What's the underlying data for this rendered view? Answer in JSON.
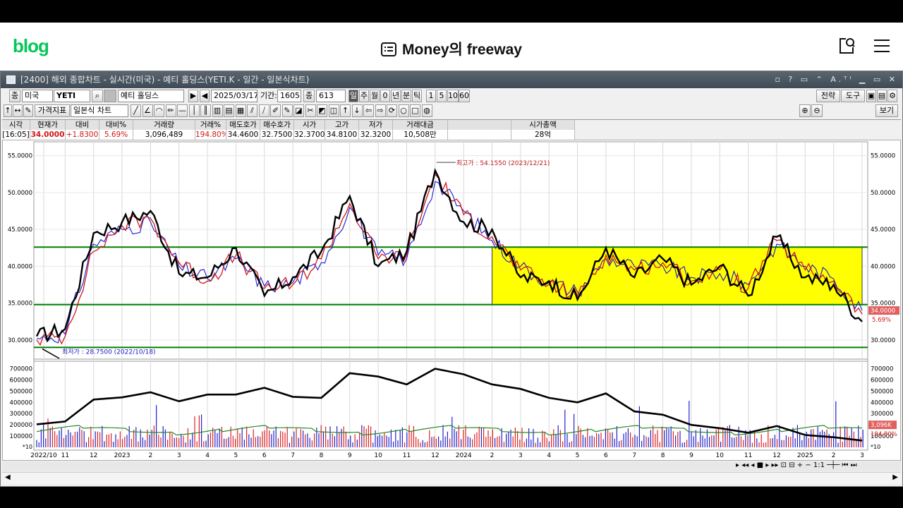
{
  "blog": {
    "logo": "blog",
    "title": "Money의 freeway"
  },
  "window": {
    "title": "[2400] 해외 종합차트 - 실시간(미국) - 예티 홀딩스(YETI.K - 일간 - 일본식차트)",
    "controls": "▫ ? ▭ ⌃ A.ᵀᴵ ▁ ▭ ✕"
  },
  "toolbar1": {
    "type_label": "종",
    "market": "미국",
    "ticker": "YETI",
    "name": "예티 홀딩스",
    "date": "2025/03/17",
    "period_label": "기간:",
    "period": "1605",
    "count_label": "종",
    "count": "613",
    "intervals": [
      "일",
      "주",
      "월",
      "0",
      "년",
      "분",
      "틱",
      "1",
      "5",
      "10",
      "60"
    ],
    "right_buttons": [
      "전략",
      "도구"
    ]
  },
  "toolbar2": {
    "indicator_label": "가격지표",
    "chart_type": "일본식 차트",
    "view_label": "보기"
  },
  "info": {
    "headers": [
      "시각",
      "현재가",
      "대비",
      "대비%",
      "거래량",
      "거래%",
      "매도호가",
      "매수호가",
      "시가",
      "고가",
      "저가",
      "거래대금",
      "",
      "시가총액"
    ],
    "values": [
      "[16:05]",
      "34.0000",
      "+1.8300",
      "5.69%",
      "3,096,489",
      "194.80%",
      "34.4600",
      "32.7500",
      "32.3700",
      "34.8100",
      "32.3200",
      "10,508만",
      "",
      "28억"
    ]
  },
  "annotations": {
    "high": "최고가 : 54.1550 (2023/12/21)",
    "low": "최저가 : 28.7500 (2022/10/18)",
    "current_price": "34.0000",
    "current_pct": "5.69%",
    "volume_current": "3,096K",
    "volume_pct": "194.80%",
    "price_mult": "",
    "vol_mult": "*10"
  },
  "colors": {
    "price": "#000000",
    "ma_red": "#d01818",
    "ma_blue": "#1a1acc",
    "support": "#008000",
    "box": "#ffff00",
    "vol_ma": "#2a8a2a"
  },
  "chart_data": {
    "type": "line",
    "price_axis": {
      "ticks": [
        "55.0000",
        "50.0000",
        "45.0000",
        "40.0000",
        "35.0000",
        "30.0000"
      ],
      "ylim": [
        27.5,
        56.5
      ]
    },
    "volume_axis": {
      "ticks": [
        "700000",
        "600000",
        "500000",
        "400000",
        "300000",
        "200000",
        "100000"
      ],
      "ylim": [
        0,
        760000
      ]
    },
    "x_ticks": [
      "2022/10",
      "11",
      "12",
      "2023",
      "2",
      "3",
      "4",
      "5",
      "6",
      "7",
      "8",
      "9",
      "10",
      "11",
      "12",
      "2024",
      "2",
      "3",
      "4",
      "5",
      "6",
      "7",
      "8",
      "9",
      "10",
      "11",
      "12",
      "2025",
      "2",
      "3"
    ],
    "horizontal_lines": [
      42.6,
      34.8,
      29.0
    ],
    "highlight_box": {
      "from": "2024/02",
      "to": "2025/03",
      "low": 34.8,
      "high": 42.6
    },
    "series": [
      {
        "name": "",
        "x": [
          "2022/10",
          "2022/11",
          "2022/12",
          "2023/01",
          "2023/02",
          "2023/03",
          "2023/04",
          "2023/05",
          "2023/06",
          "2023/07",
          "2023/08",
          "2023/09",
          "2023/10",
          "2023/11",
          "2023/12",
          "2024/01",
          "2024/02",
          "2024/03",
          "2024/04",
          "2024/05",
          "2024/06",
          "2024/07",
          "2024/08",
          "2024/09",
          "2024/10",
          "2024/11",
          "2024/12",
          "2025/01",
          "2025/02",
          "2025/03"
        ],
        "values": [
          30.5,
          31.5,
          44.5,
          46.0,
          47.5,
          39.0,
          38.5,
          42.5,
          36.0,
          38.5,
          42.0,
          49.5,
          40.0,
          42.0,
          53.0,
          46.0,
          45.0,
          38.5,
          38.0,
          35.5,
          42.5,
          38.5,
          41.0,
          37.5,
          40.0,
          36.0,
          44.0,
          38.5,
          37.5,
          32.5
        ]
      },
      {
        "name": "",
        "values": [
          30.0,
          30.5,
          42.0,
          45.5,
          46.5,
          40.5,
          38.0,
          41.5,
          37.0,
          37.5,
          41.0,
          48.5,
          41.0,
          41.5,
          52.5,
          47.0,
          44.0,
          39.5,
          37.5,
          36.0,
          41.5,
          39.5,
          40.5,
          38.0,
          39.5,
          37.0,
          43.5,
          39.5,
          38.0,
          33.5
        ]
      },
      {
        "name": "",
        "values": [
          30.2,
          30.8,
          43.0,
          45.0,
          46.0,
          40.0,
          38.3,
          41.0,
          37.3,
          37.8,
          40.5,
          48.0,
          41.5,
          41.0,
          51.5,
          47.5,
          43.5,
          40.0,
          37.8,
          36.5,
          41.0,
          40.0,
          40.0,
          38.5,
          39.0,
          37.5,
          43.0,
          40.0,
          38.3,
          34.0
        ]
      }
    ],
    "volume_ma": [
      205000,
      230000,
      425000,
      445000,
      490000,
      410000,
      470000,
      470000,
      530000,
      450000,
      440000,
      660000,
      630000,
      560000,
      700000,
      650000,
      560000,
      520000,
      440000,
      400000,
      480000,
      320000,
      290000,
      200000,
      170000,
      130000,
      190000,
      110000,
      90000,
      60000
    ]
  }
}
